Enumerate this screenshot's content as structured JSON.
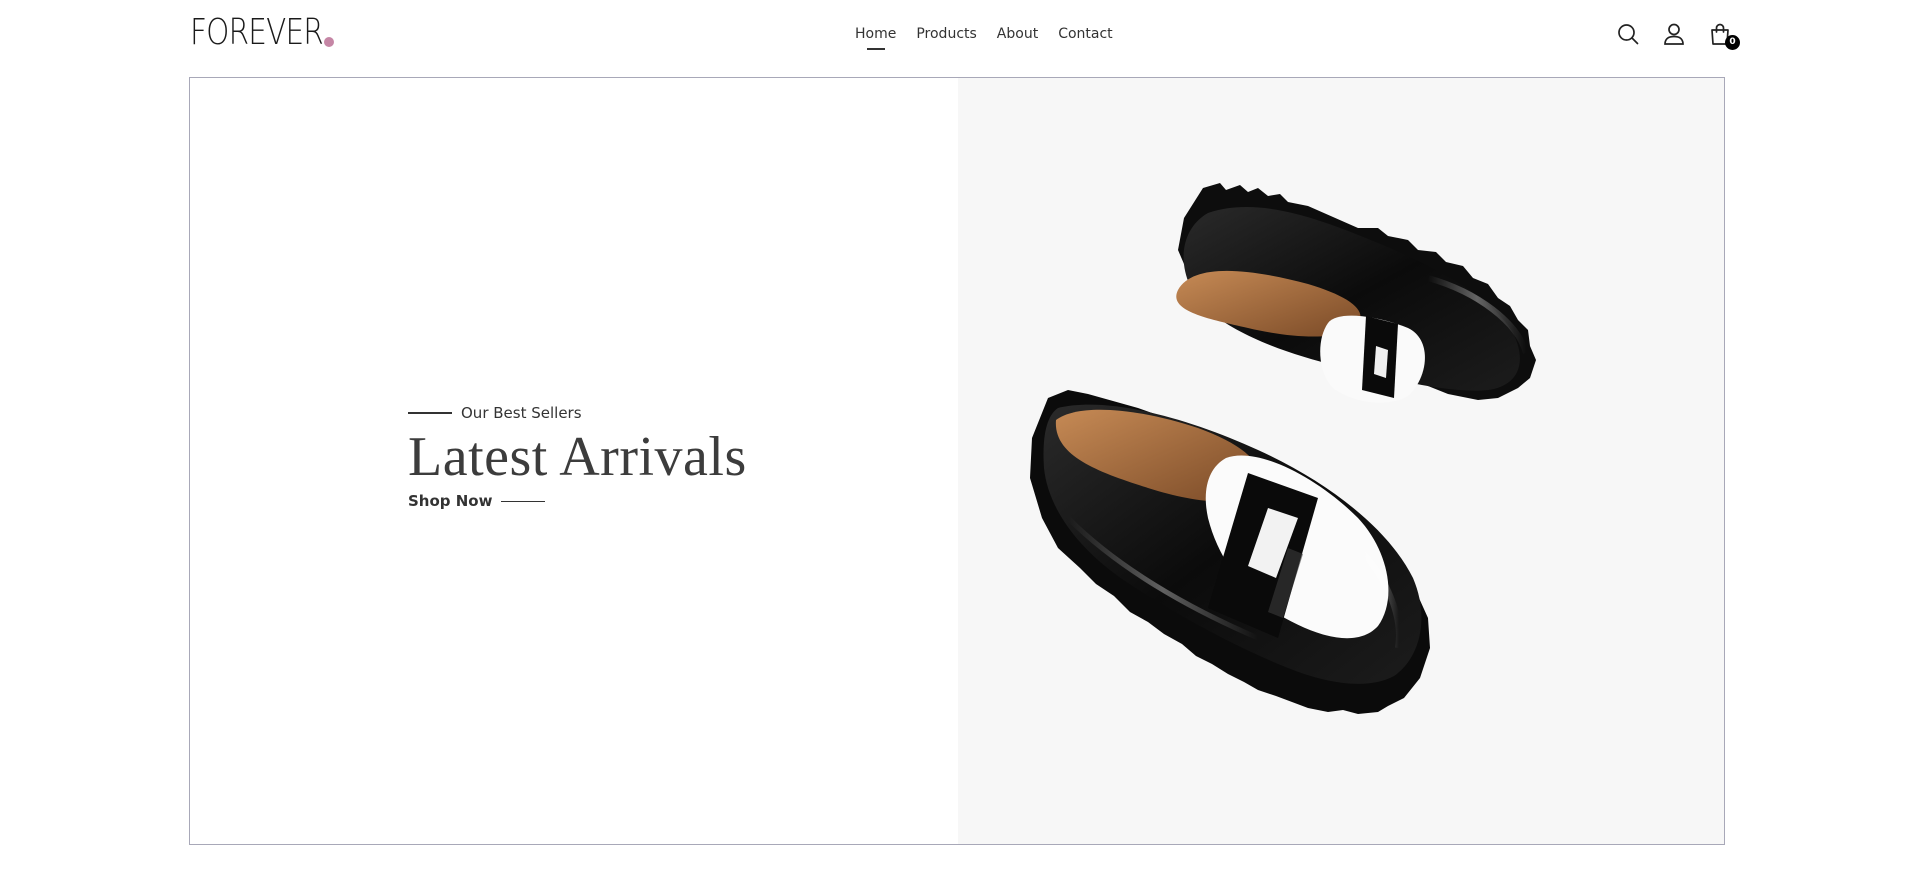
{
  "brand": {
    "logo_text": "FOREVER",
    "accent_color": "#c586a5"
  },
  "nav": {
    "links": [
      {
        "label": "Home",
        "active": true
      },
      {
        "label": "Products",
        "active": false
      },
      {
        "label": "About",
        "active": false
      },
      {
        "label": "Contact",
        "active": false
      }
    ]
  },
  "header_icons": {
    "search": "search-icon",
    "account": "user-icon",
    "cart": "shopping-bag-icon",
    "cart_count": "0"
  },
  "hero": {
    "eyebrow": "Our Best Sellers",
    "title": "Latest Arrivals",
    "cta_label": "Shop Now",
    "image_subject": "black-and-white-penny-loafers"
  }
}
